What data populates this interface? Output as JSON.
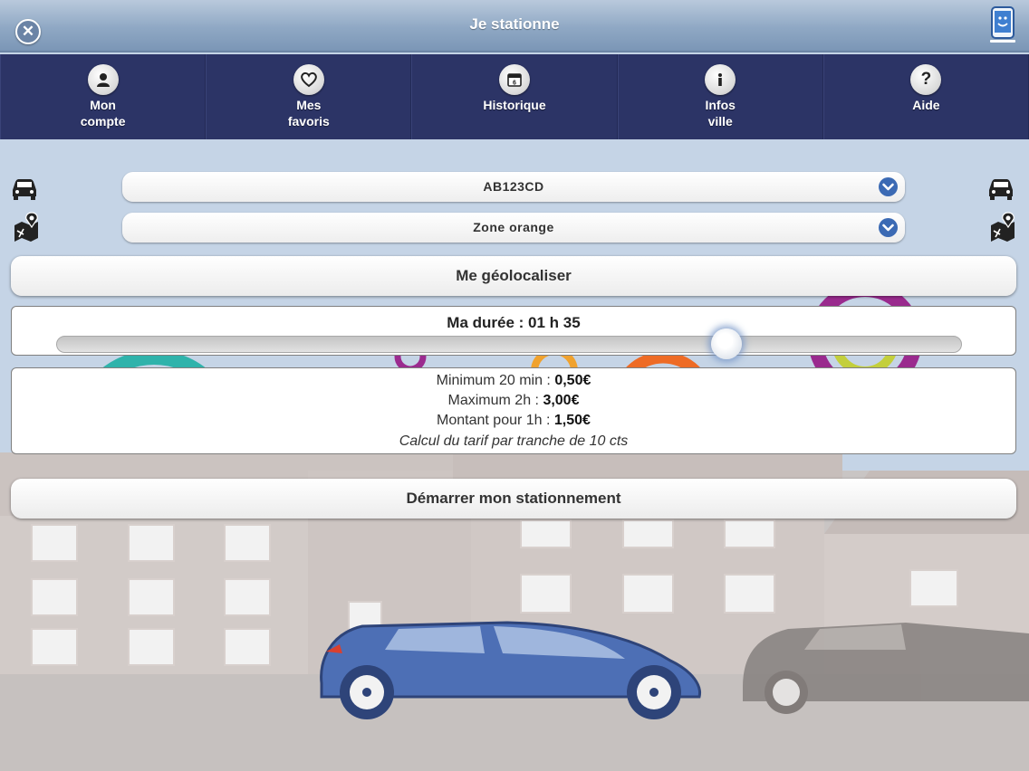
{
  "titlebar": {
    "title": "Je stationne",
    "close_icon": "close-icon",
    "app_icon": "phone-smile-icon"
  },
  "nav": [
    {
      "icon": "user-icon",
      "label_line1": "Mon",
      "label_line2": "compte"
    },
    {
      "icon": "heart-icon",
      "label_line1": "Mes",
      "label_line2": "favoris"
    },
    {
      "icon": "calendar-icon",
      "label_line1": "Historique",
      "label_line2": ""
    },
    {
      "icon": "info-icon",
      "label_line1": "Infos",
      "label_line2": "ville"
    },
    {
      "icon": "help-icon",
      "label_line1": "Aide",
      "label_line2": ""
    }
  ],
  "vehicle_select": {
    "value": "AB123CD",
    "icon": "car-icon"
  },
  "zone_select": {
    "value": "Zone orange",
    "icon": "map-pin-icon"
  },
  "geolocate_button": "Me géolocaliser",
  "duration": {
    "label": "Ma durée : 01 h 35",
    "slider_fraction": 0.74
  },
  "tarif": {
    "min_prefix": "Minimum 20 min : ",
    "min_value": "0,50€",
    "max_prefix": "Maximum 2h : ",
    "max_value": "3,00€",
    "hour_prefix": "Montant pour 1h : ",
    "hour_value": "1,50€",
    "note": "Calcul du tarif par tranche de 10 cts"
  },
  "start_button": "Démarrer mon stationnement",
  "colors": {
    "nav_bg": "#2c3466",
    "accent": "#3b6ab4",
    "car_blue": "#4d6fb5"
  }
}
